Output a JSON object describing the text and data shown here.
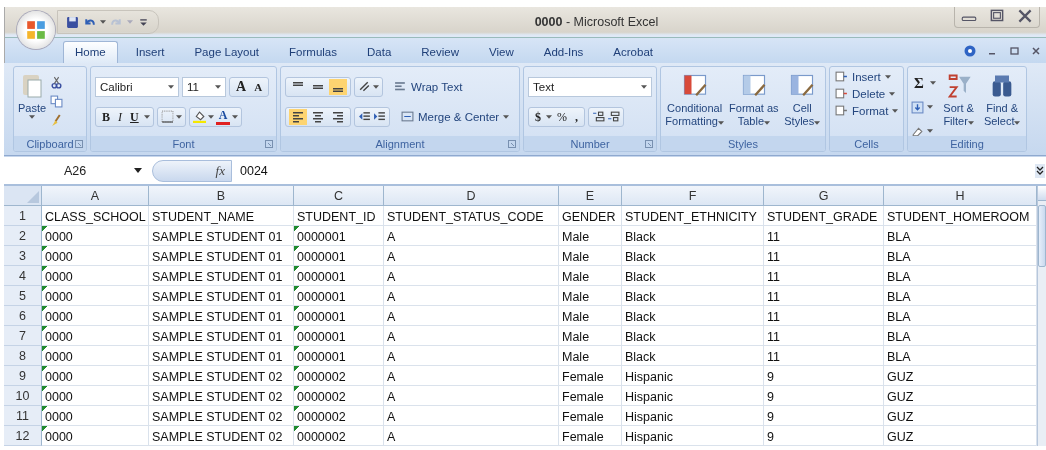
{
  "window": {
    "title": "**0000** - Microsoft Excel"
  },
  "tabs": [
    {
      "label": "Home",
      "selected": true
    },
    {
      "label": "Insert",
      "selected": false
    },
    {
      "label": "Page Layout",
      "selected": false
    },
    {
      "label": "Formulas",
      "selected": false
    },
    {
      "label": "Data",
      "selected": false
    },
    {
      "label": "Review",
      "selected": false
    },
    {
      "label": "View",
      "selected": false
    },
    {
      "label": "Add-Ins",
      "selected": false
    },
    {
      "label": "Acrobat",
      "selected": false
    }
  ],
  "ribbon": {
    "clipboard": {
      "label": "Clipboard",
      "paste": "Paste"
    },
    "font": {
      "label": "Font",
      "family": "Calibri",
      "size": "11",
      "grow": "A",
      "shrink": "A",
      "bold": "B",
      "italic": "I",
      "underline": "U",
      "color_letter": "A"
    },
    "alignment": {
      "label": "Alignment",
      "vertical": [
        {
          "selected": false
        },
        {
          "selected": false
        },
        {
          "selected": true
        }
      ],
      "horizontal": [
        {
          "selected": true
        },
        {
          "selected": false
        },
        {
          "selected": false
        }
      ],
      "wrap": "Wrap Text",
      "merge": "Merge & Center"
    },
    "number": {
      "label": "Number",
      "format": "Text",
      "currency": "$",
      "percent": "%",
      "comma": ","
    },
    "styles": {
      "label": "Styles",
      "buttons": [
        "Conditional Formatting",
        "Format as Table",
        "Cell Styles"
      ]
    },
    "cells": {
      "label": "Cells",
      "buttons": [
        "Insert",
        "Delete",
        "Format"
      ]
    },
    "editing": {
      "label": "Editing",
      "autosum": "Σ",
      "buttons": [
        "Sort & Filter",
        "Find & Select"
      ]
    }
  },
  "formula_bar": {
    "name_box": "A26",
    "function_label": "fx",
    "value": "0024"
  },
  "sheet": {
    "columns": [
      {
        "letter": "A",
        "flagged": true
      },
      {
        "letter": "B",
        "flagged": false
      },
      {
        "letter": "C",
        "flagged": true
      },
      {
        "letter": "D",
        "flagged": false
      },
      {
        "letter": "E",
        "flagged": false
      },
      {
        "letter": "F",
        "flagged": false
      },
      {
        "letter": "G",
        "flagged": false
      },
      {
        "letter": "H",
        "flagged": false
      }
    ],
    "header_row": {
      "number": "1",
      "cells": [
        "CLASS_SCHOOL",
        "STUDENT_NAME",
        "STUDENT_ID",
        "STUDENT_STATUS_CODE",
        "GENDER",
        "STUDENT_ETHNICITY",
        "STUDENT_GRADE",
        "STUDENT_HOMEROOM"
      ]
    },
    "rows": [
      {
        "number": "2",
        "cells": [
          "0000",
          "SAMPLE STUDENT 01",
          "0000001",
          "A",
          "Male",
          "Black",
          "11",
          "BLA"
        ]
      },
      {
        "number": "3",
        "cells": [
          "0000",
          "SAMPLE STUDENT 01",
          "0000001",
          "A",
          "Male",
          "Black",
          "11",
          "BLA"
        ]
      },
      {
        "number": "4",
        "cells": [
          "0000",
          "SAMPLE STUDENT 01",
          "0000001",
          "A",
          "Male",
          "Black",
          "11",
          "BLA"
        ]
      },
      {
        "number": "5",
        "cells": [
          "0000",
          "SAMPLE STUDENT 01",
          "0000001",
          "A",
          "Male",
          "Black",
          "11",
          "BLA"
        ]
      },
      {
        "number": "6",
        "cells": [
          "0000",
          "SAMPLE STUDENT 01",
          "0000001",
          "A",
          "Male",
          "Black",
          "11",
          "BLA"
        ]
      },
      {
        "number": "7",
        "cells": [
          "0000",
          "SAMPLE STUDENT 01",
          "0000001",
          "A",
          "Male",
          "Black",
          "11",
          "BLA"
        ]
      },
      {
        "number": "8",
        "cells": [
          "0000",
          "SAMPLE STUDENT 01",
          "0000001",
          "A",
          "Male",
          "Black",
          "11",
          "BLA"
        ]
      },
      {
        "number": "9",
        "cells": [
          "0000",
          "SAMPLE STUDENT 02",
          "0000002",
          "A",
          "Female",
          "Hispanic",
          "9",
          "GUZ"
        ]
      },
      {
        "number": "10",
        "cells": [
          "0000",
          "SAMPLE STUDENT 02",
          "0000002",
          "A",
          "Female",
          "Hispanic",
          "9",
          "GUZ"
        ]
      },
      {
        "number": "11",
        "cells": [
          "0000",
          "SAMPLE STUDENT 02",
          "0000002",
          "A",
          "Female",
          "Hispanic",
          "9",
          "GUZ"
        ]
      },
      {
        "number": "12",
        "cells": [
          "0000",
          "SAMPLE STUDENT 02",
          "0000002",
          "A",
          "Female",
          "Hispanic",
          "9",
          "GUZ"
        ]
      }
    ]
  }
}
